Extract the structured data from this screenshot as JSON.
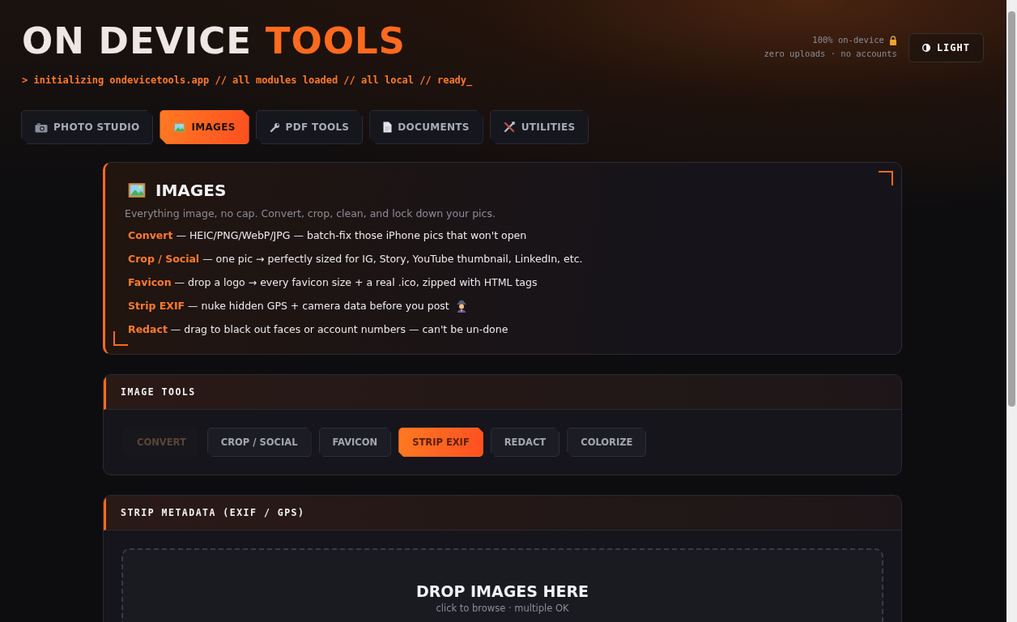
{
  "header": {
    "title_main": "ON DEVICE",
    "title_accent": "TOOLS",
    "boot_line": "> initializing ondevicetools.app // all modules loaded // all local // ready_",
    "badge_line_1": "100% on-device",
    "badge_line_2": "zero uploads · no accounts",
    "theme_button": "LIGHT"
  },
  "tabs": [
    {
      "label": "PHOTO STUDIO",
      "selected": false
    },
    {
      "label": "IMAGES",
      "selected": true
    },
    {
      "label": "PDF TOOLS",
      "selected": false
    },
    {
      "label": "DOCUMENTS",
      "selected": false
    },
    {
      "label": "UTILITIES",
      "selected": false
    }
  ],
  "intro": {
    "title": "IMAGES",
    "subtitle": "Everything image, no cap. Convert, crop, clean, and lock down your pics.",
    "features": [
      {
        "name": "Convert",
        "text": "— HEIC/PNG/WebP/JPG — batch-fix those iPhone pics that won't open",
        "kind": "plain"
      },
      {
        "name": "Crop / Social",
        "text": "— one pic → perfectly sized for IG, Story, YouTube thumbnail, LinkedIn, etc.",
        "kind": "plain"
      },
      {
        "name": "Favicon",
        "text": "— drop a logo → every favicon size + a real .ico, zipped with HTML tags",
        "kind": "plain"
      },
      {
        "name": "Strip EXIF",
        "text": "— nuke hidden GPS + camera data before you post",
        "kind": "with-icon"
      },
      {
        "name": "Redact",
        "text": "— drag to black out faces or account numbers — can't be un-done",
        "kind": "plain"
      }
    ]
  },
  "image_tools": {
    "title": "IMAGE TOOLS",
    "tools": [
      {
        "label": "CONVERT",
        "selected": false,
        "dimmed": true
      },
      {
        "label": "CROP / SOCIAL",
        "selected": false,
        "dimmed": false
      },
      {
        "label": "FAVICON",
        "selected": false,
        "dimmed": false
      },
      {
        "label": "STRIP EXIF",
        "selected": true,
        "dimmed": false
      },
      {
        "label": "REDACT",
        "selected": false,
        "dimmed": false
      },
      {
        "label": "COLORIZE",
        "selected": false,
        "dimmed": false
      }
    ]
  },
  "strip_panel": {
    "title": "STRIP METADATA (EXIF / GPS)",
    "drop_title": "DROP IMAGES HERE",
    "drop_hint": "click to browse · multiple OK"
  }
}
